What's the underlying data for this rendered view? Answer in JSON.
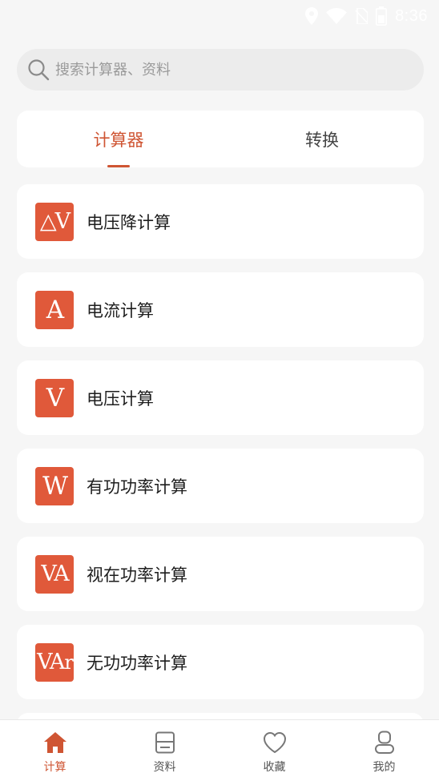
{
  "status_bar": {
    "time": "8:36",
    "icons": [
      "location-icon",
      "wifi-icon",
      "no-sim-icon",
      "battery-icon"
    ]
  },
  "search": {
    "placeholder": "搜索计算器、资料",
    "value": ""
  },
  "tabs": [
    {
      "label": "计算器",
      "active": true
    },
    {
      "label": "转换",
      "active": false
    }
  ],
  "calculators": [
    {
      "icon_text": "△V",
      "label": "电压降计算"
    },
    {
      "icon_text": "A",
      "label": "电流计算"
    },
    {
      "icon_text": "V",
      "label": "电压计算"
    },
    {
      "icon_text": "W",
      "label": "有功功率计算"
    },
    {
      "icon_text": "VA",
      "label": "视在功率计算"
    },
    {
      "icon_text_main": "VA",
      "icon_text_sub": "r",
      "label": "无功功率计算"
    }
  ],
  "bottom_nav": [
    {
      "label": "计算",
      "icon": "home-icon",
      "active": true
    },
    {
      "label": "资料",
      "icon": "document-icon",
      "active": false
    },
    {
      "label": "收藏",
      "icon": "heart-icon",
      "active": false
    },
    {
      "label": "我的",
      "icon": "profile-icon",
      "active": false
    }
  ],
  "colors": {
    "accent": "#cf5533",
    "icon_bg": "#e0593a",
    "background": "#f6f6f6",
    "card": "#ffffff"
  }
}
